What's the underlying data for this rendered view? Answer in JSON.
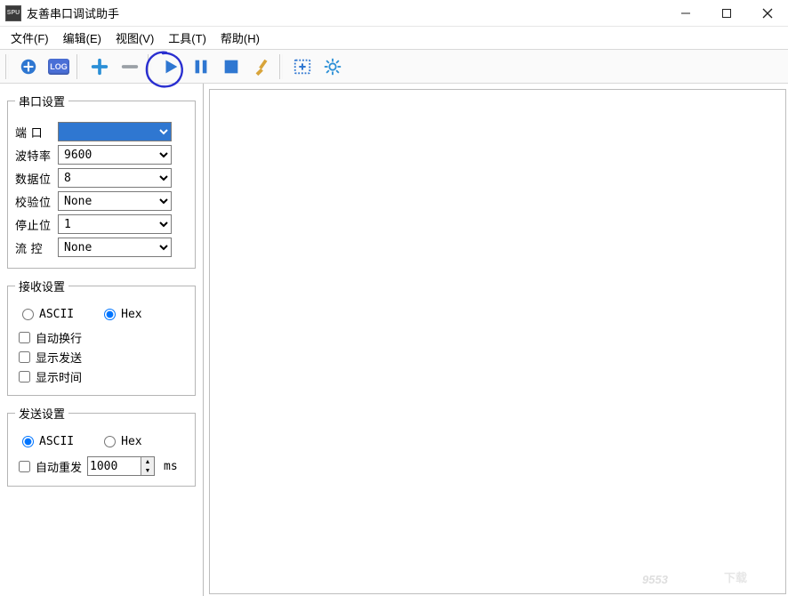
{
  "window": {
    "title": "友善串口调试助手",
    "app_icon_text": "SPU"
  },
  "menu": {
    "file": "文件(F)",
    "edit": "编辑(E)",
    "view": "视图(V)",
    "tools": "工具(T)",
    "help": "帮助(H)"
  },
  "toolbar": {
    "icons": {
      "add_port": "add-port-icon",
      "log": "LOG",
      "plus": "plus-icon",
      "minus": "minus-icon",
      "play": "play-icon",
      "pause": "pause-icon",
      "stop": "stop-icon",
      "clear": "brush-icon",
      "new_tab": "new-tab-icon",
      "settings": "gear-icon"
    }
  },
  "serial": {
    "legend": "串口设置",
    "port_label": "端  口",
    "port_value": "",
    "baud_label": "波特率",
    "baud_value": "9600",
    "databits_label": "数据位",
    "databits_value": "8",
    "parity_label": "校验位",
    "parity_value": "None",
    "stopbits_label": "停止位",
    "stopbits_value": "1",
    "flow_label": "流  控",
    "flow_value": "None"
  },
  "recv": {
    "legend": "接收设置",
    "ascii": "ASCII",
    "hex": "Hex",
    "selected": "hex",
    "wrap": "自动换行",
    "show_send": "显示发送",
    "show_time": "显示时间"
  },
  "send": {
    "legend": "发送设置",
    "ascii": "ASCII",
    "hex": "Hex",
    "selected": "ascii",
    "auto_resend": "自动重发",
    "interval": "1000",
    "unit": "ms"
  },
  "watermark": "9553下载"
}
